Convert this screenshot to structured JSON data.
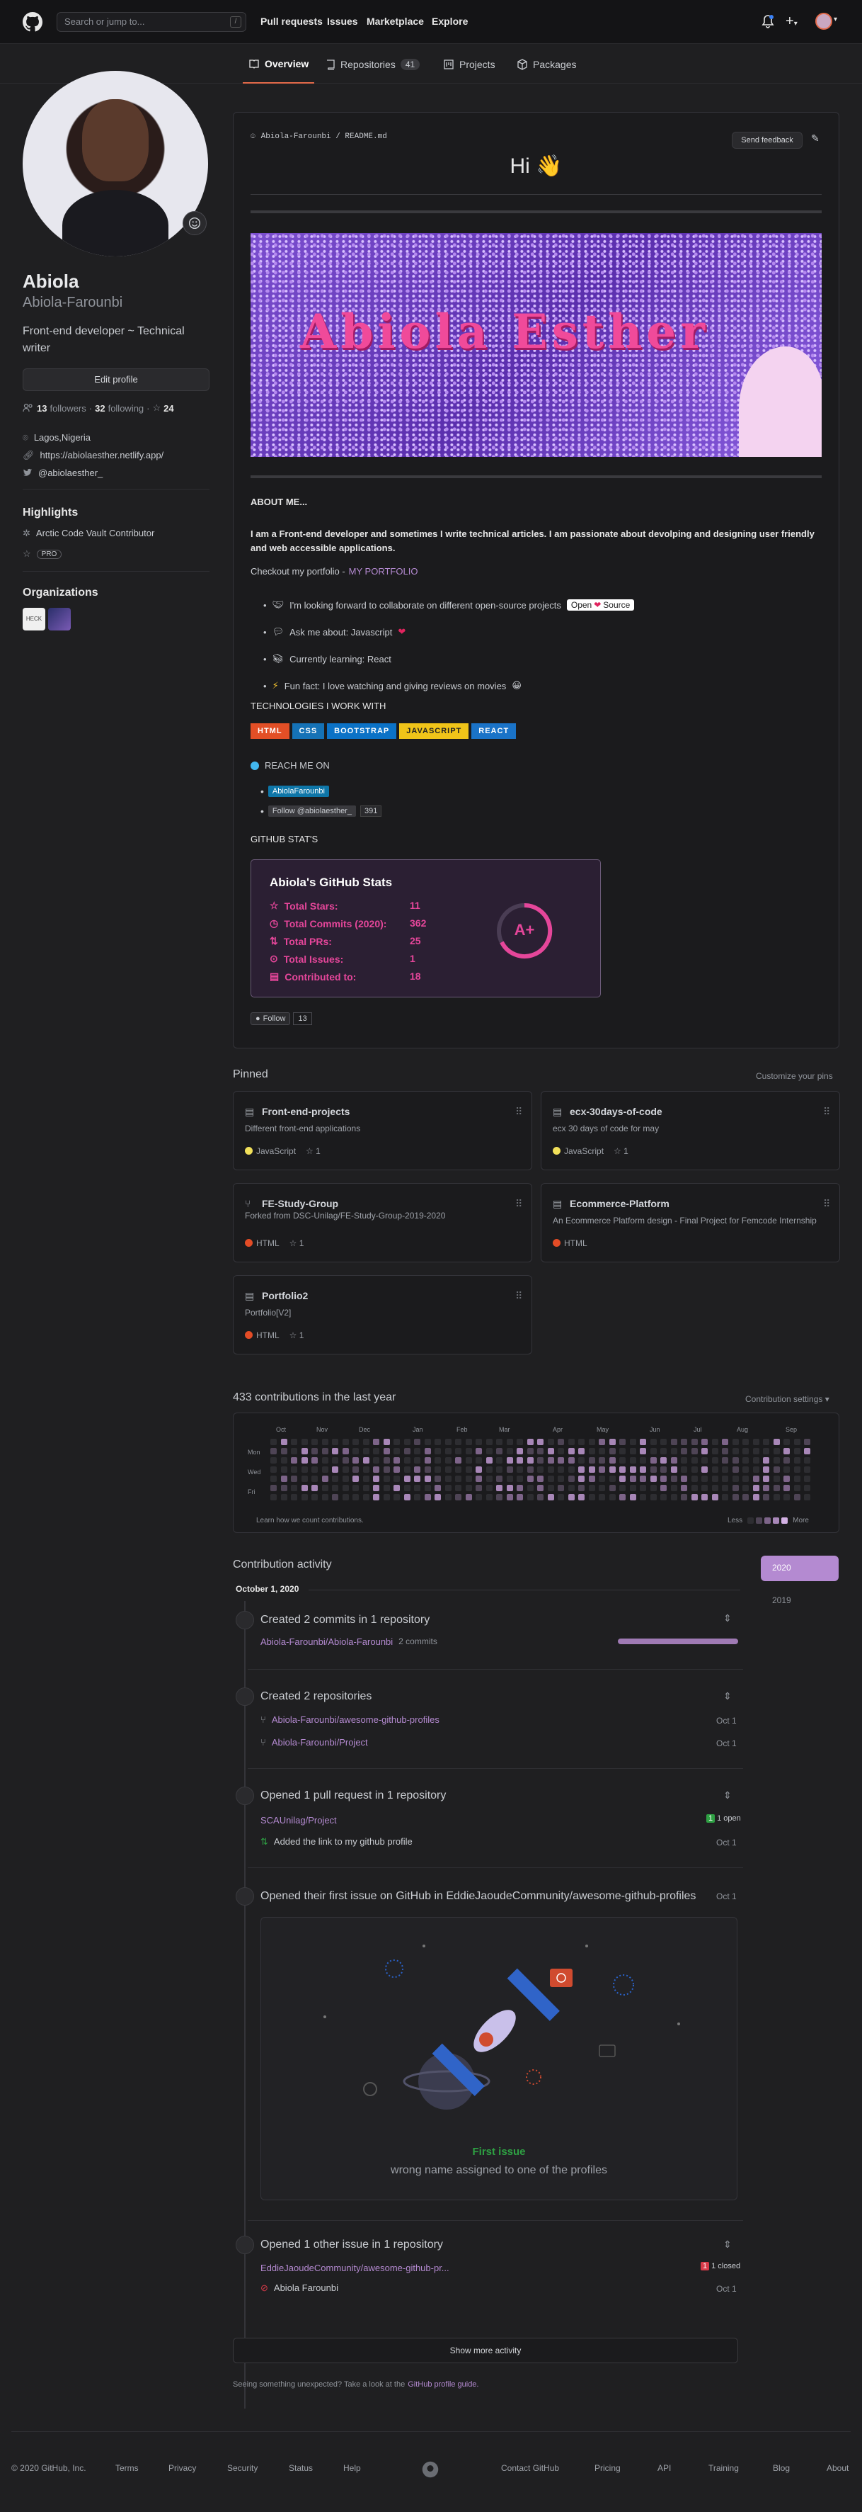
{
  "header": {
    "search_placeholder": "Search or jump to...",
    "search_key": "/",
    "nav": [
      "Pull requests",
      "Issues",
      "Marketplace",
      "Explore"
    ]
  },
  "tabs": [
    {
      "label": "Overview"
    },
    {
      "label": "Repositories",
      "count": "41"
    },
    {
      "label": "Projects"
    },
    {
      "label": "Packages"
    }
  ],
  "profile": {
    "name": "Abiola",
    "login": "Abiola-Farounbi",
    "bio": "Front-end developer ~ Technical writer",
    "edit_label": "Edit profile",
    "followers": "13",
    "followers_label": "followers",
    "following": "32",
    "following_label": "following",
    "stars": "24",
    "location": "Lagos,Nigeria",
    "website": "https://abiolaesther.netlify.app/",
    "twitter": "@abiolaesther_",
    "highlights_title": "Highlights",
    "highlight_1": "Arctic Code Vault Contributor",
    "highlight_2": "PRO",
    "orgs_title": "Organizations",
    "org_1_text": "HECK"
  },
  "readme": {
    "path": "Abiola-Farounbi / README.md",
    "feedback": "Send feedback",
    "hi": "Hi 👋",
    "banner_text": "Abiola Esther",
    "about_title": "ABOUT ME...",
    "about_text": "I am a Front-end developer and sometimes I write technical articles. I am passionate about devolping and designing user friendly and web accessible applications.",
    "portfolio_prefix": "Checkout my portfolio -",
    "portfolio_link": "MY PORTFOLIO",
    "bullets": [
      "I'm looking forward to collaborate on different open-source projects",
      "Ask me about: Javascript",
      "Currently learning: React",
      "Fun fact: I love watching and giving reviews on movies"
    ],
    "open_source_open": "Open",
    "open_source_source": "Source",
    "tech_title": "TECHNOLOGIES I WORK WITH",
    "tech": [
      {
        "label": "HTML",
        "color": "#e34f26"
      },
      {
        "label": "CSS",
        "color": "#1572b6"
      },
      {
        "label": "BOOTSTRAP",
        "color": "#0b72c6"
      },
      {
        "label": "JAVASCRIPT",
        "color": "#f0c419"
      },
      {
        "label": "REACT",
        "color": "#1a73c8"
      }
    ],
    "reach_title": "REACH ME ON",
    "linkedin": "AbiolaFarounbi",
    "twitter_follow": "Follow @abiolaesther_",
    "twitter_count": "391",
    "stats_title": "GITHUB STAT'S",
    "stats_card_title": "Abiola's GitHub Stats",
    "stats": [
      {
        "label": "Total Stars:",
        "value": "11"
      },
      {
        "label": "Total Commits (2020):",
        "value": "362"
      },
      {
        "label": "Total PRs:",
        "value": "25"
      },
      {
        "label": "Total Issues:",
        "value": "1"
      },
      {
        "label": "Contributed to:",
        "value": "18"
      }
    ],
    "rank": "A+",
    "follow_label": "Follow",
    "follow_count": "13"
  },
  "pinned": {
    "title": "Pinned",
    "customize": "Customize your pins",
    "items": [
      {
        "name": "Front-end-projects",
        "desc": "Different front-end applications",
        "lang": "JavaScript",
        "lang_color": "#f1e05a",
        "stars": "1"
      },
      {
        "name": "ecx-30days-of-code",
        "desc": "ecx 30 days of code for may",
        "lang": "JavaScript",
        "lang_color": "#f1e05a",
        "stars": "1"
      },
      {
        "name": "FE-Study-Group",
        "desc": "Forked from DSC-Unilag/FE-Study-Group-2019-2020",
        "lang": "HTML",
        "lang_color": "#e34c26",
        "stars": "1"
      },
      {
        "name": "Ecommerce-Platform",
        "desc": "An Ecommerce Platform design - Final Project for Femcode Internship",
        "lang": "HTML",
        "lang_color": "#e34c26",
        "stars": ""
      },
      {
        "name": "Portfolio2",
        "desc": "Portfolio[V2]",
        "lang": "HTML",
        "lang_color": "#e34c26",
        "stars": "1"
      }
    ]
  },
  "contrib": {
    "title": "433 contributions in the last year",
    "settings": "Contribution settings ▾",
    "months": [
      "Oct",
      "Nov",
      "Dec",
      "Jan",
      "Feb",
      "Mar",
      "Apr",
      "May",
      "Jun",
      "Jul",
      "Aug",
      "Sep"
    ],
    "days": [
      "Mon",
      "Wed",
      "Fri"
    ],
    "learn": "Learn how we count contributions.",
    "less": "Less",
    "more": "More"
  },
  "activity": {
    "title": "Contribution activity",
    "month": "October 1, 2020",
    "years": [
      "2020",
      "2019"
    ],
    "commits_title": "Created 2 commits in 1 repository",
    "commits_repo": "Abiola-Farounbi/Abiola-Farounbi",
    "commits_count": "2 commits",
    "repos_title": "Created 2 repositories",
    "repo_1": "Abiola-Farounbi/awesome-github-profiles",
    "repo_2": "Abiola-Farounbi/Project",
    "date": "Oct 1",
    "pr_title": "Opened 1 pull request in 1 repository",
    "pr_repo": "SCAUnilag/Project",
    "pr_state": "1 open",
    "pr_item": "Added the link to my github profile",
    "first_issue_title": "Opened their first issue on GitHub in EddieJaoudeCommunity/awesome-github-profiles",
    "first_issue_label": "First issue",
    "first_issue_text": "wrong name assigned to one of the profiles",
    "other_issue_title": "Opened 1 other issue in 1 repository",
    "other_issue_repo": "EddieJaoudeCommunity/awesome-github-pr...",
    "other_issue_state": "1 closed",
    "other_issue_item": "Abiola Farounbi",
    "show_more": "Show more activity",
    "unexpected_prefix": "Seeing something unexpected? Take a look at the",
    "unexpected_link": "GitHub profile guide."
  },
  "footer": {
    "left": [
      "© 2020 GitHub, Inc.",
      "Terms",
      "Privacy",
      "Security",
      "Status",
      "Help"
    ],
    "right": [
      "Contact GitHub",
      "Pricing",
      "API",
      "Training",
      "Blog",
      "About"
    ]
  }
}
